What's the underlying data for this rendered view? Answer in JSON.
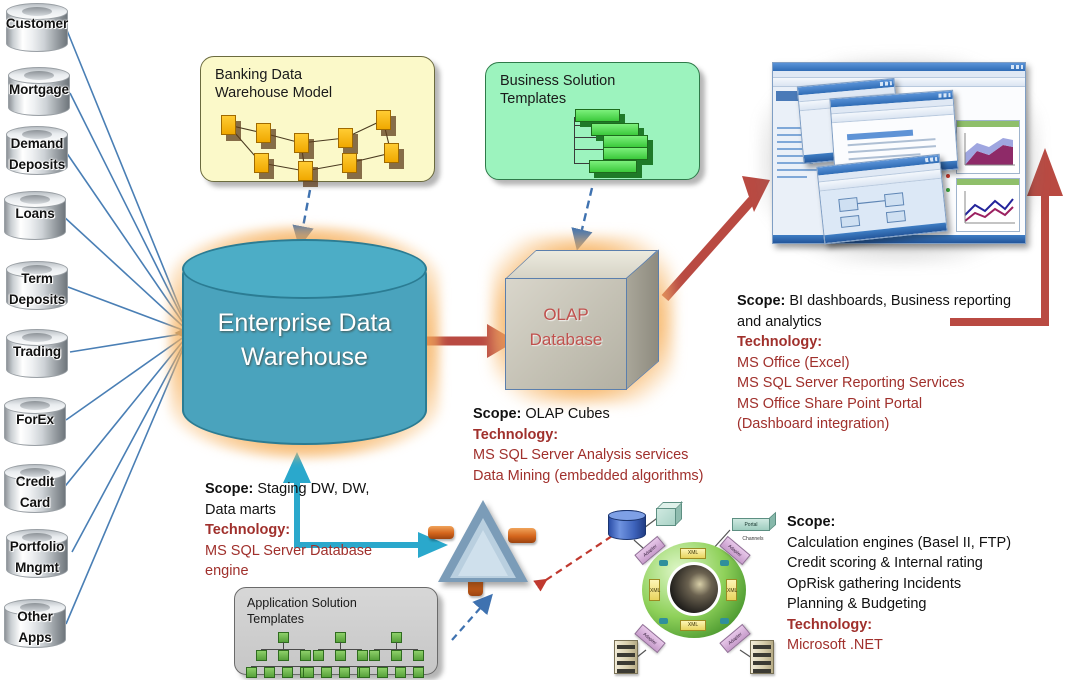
{
  "sources": {
    "items": [
      {
        "label": "Customer"
      },
      {
        "label": "Mortgage"
      },
      {
        "label": "Demand Deposits"
      },
      {
        "label": "Loans"
      },
      {
        "label": "Term Deposits"
      },
      {
        "label": "Trading"
      },
      {
        "label": "ForEx"
      },
      {
        "label": "Credit Card"
      },
      {
        "label": "Portfolio Mngmt"
      },
      {
        "label": "Other Apps"
      }
    ]
  },
  "boxes": {
    "banking_model": {
      "title_line1": "Banking Data",
      "title_line2": "Warehouse Model"
    },
    "business_templates": {
      "title_line1": "Business Solution",
      "title_line2": "Templates"
    },
    "app_templates": {
      "title_line1": "Application Solution",
      "title_line2": "Templates"
    }
  },
  "edw": {
    "line1": "Enterprise Data",
    "line2": "Warehouse"
  },
  "olap": {
    "line1": "OLAP",
    "line2": "Database"
  },
  "network": {
    "portal_label": "Portal",
    "channels_label": "Channels",
    "xml_label": "XML",
    "adapter_label": "Adapter"
  },
  "scope_edw": {
    "scope_key": "Scope:",
    "scope_value": " Staging DW, DW,",
    "scope_line2": "Data marts",
    "tech_key": "Technology:",
    "tech_lines": [
      "MS SQL Server Database",
      "engine"
    ]
  },
  "scope_olap": {
    "scope_key": "Scope:",
    "scope_value": " OLAP Cubes",
    "tech_key": "Technology:",
    "tech_lines": [
      "MS SQL Server Analysis services",
      "Data Mining (embedded algorithms)"
    ]
  },
  "scope_bi": {
    "scope_key": "Scope:",
    "scope_value": " BI dashboards, Business reporting",
    "scope_line2": "and analytics",
    "tech_key": "Technology:",
    "tech_lines": [
      "MS Office (Excel)",
      "MS SQL Server Reporting Services",
      "MS Office Share Point Portal",
      "(Dashboard integration)"
    ]
  },
  "scope_apps": {
    "scope_key": "Scope:",
    "scope_lines": [
      "Calculation engines (Basel II, FTP)",
      "Credit scoring & Internal rating",
      "OpRisk gathering Incidents",
      "Planning & Budgeting"
    ],
    "tech_key": "Technology:",
    "tech_lines": [
      "Microsoft .NET"
    ]
  },
  "colors": {
    "edw_fill": "#4aa3bd",
    "glow": "#f4a03c",
    "red_arrow": "#b94a42",
    "blue_line": "#3f72b0",
    "tech_text": "#a0302c",
    "yellow_box": "#fbf9c9",
    "green_box": "#9cf3be",
    "gray_box": "#cfcfcf"
  }
}
